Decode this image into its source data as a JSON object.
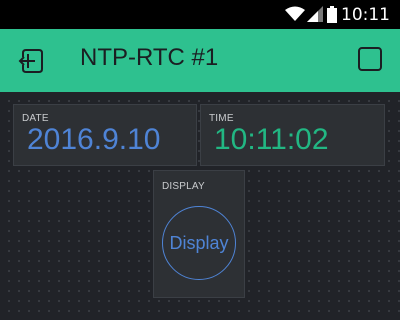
{
  "status_bar": {
    "time": "10:11",
    "icons": [
      "wifi-icon",
      "signal-icon",
      "battery-icon"
    ]
  },
  "app_bar": {
    "title": "NTP-RTC #1",
    "background_color": "#2ec18f",
    "left_icon": "exit-project-icon",
    "right_icon": "checkbox-icon"
  },
  "widgets": {
    "date": {
      "label": "DATE",
      "value": "2016.9.10",
      "color": "#4f84d6"
    },
    "time": {
      "label": "TIME",
      "value": "10:11:02",
      "color": "#22b783"
    },
    "display": {
      "label": "DISPLAY",
      "button_label": "Display",
      "color": "#4f84d6"
    }
  }
}
